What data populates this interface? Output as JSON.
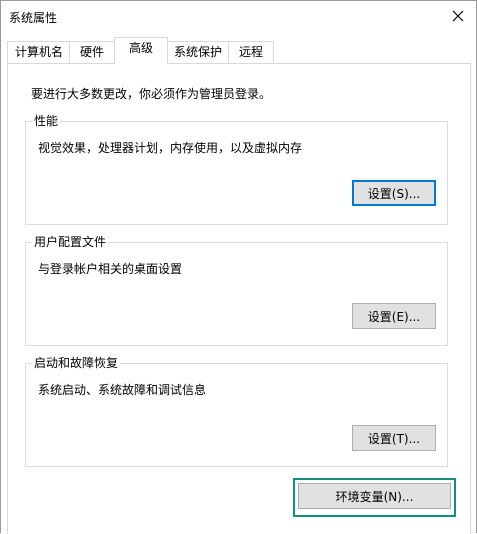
{
  "window": {
    "title": "系统属性",
    "close_icon": "close-icon"
  },
  "tabs": [
    {
      "label": "计算机名",
      "active": false
    },
    {
      "label": "硬件",
      "active": false
    },
    {
      "label": "高级",
      "active": true
    },
    {
      "label": "系统保护",
      "active": false
    },
    {
      "label": "远程",
      "active": false
    }
  ],
  "advanced": {
    "admin_note": "要进行大多数更改，你必须作为管理员登录。",
    "performance": {
      "title": "性能",
      "description": "视觉效果，处理器计划，内存使用，以及虚拟内存",
      "button_label": "设置(S)..."
    },
    "user_profiles": {
      "title": "用户配置文件",
      "description": "与登录帐户相关的桌面设置",
      "button_label": "设置(E)..."
    },
    "startup_recovery": {
      "title": "启动和故障恢复",
      "description": "系统启动、系统故障和调试信息",
      "button_label": "设置(T)..."
    },
    "env_vars_button_label": "环境变量(N)..."
  },
  "colors": {
    "focus_border": "#0078d7",
    "highlight_border": "#138e83",
    "button_face": "#e1e1e1"
  }
}
